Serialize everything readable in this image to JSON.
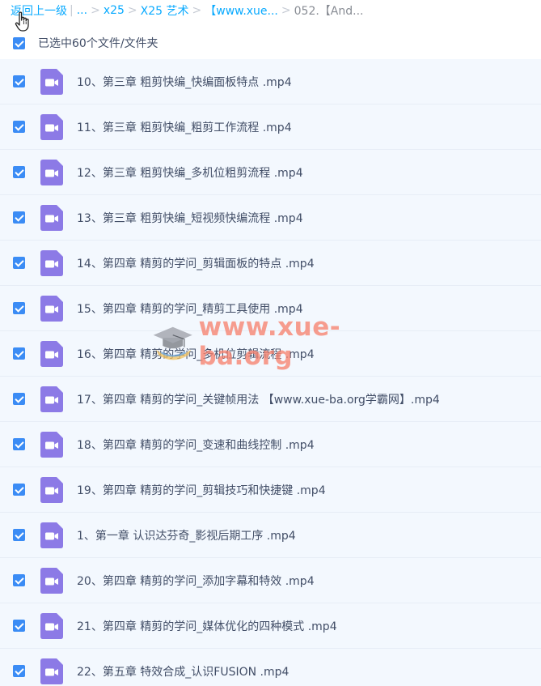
{
  "breadcrumb": {
    "back": "返回上一级",
    "pipe": "|",
    "ellipsis": "...",
    "sep": ">",
    "items": [
      "x25",
      "X25 艺术",
      "【www.xue..."
    ],
    "current": "052.【And..."
  },
  "selection": {
    "label": "已选中60个文件/文件夹"
  },
  "files": [
    {
      "name": "10、第三章 粗剪快编_快编面板特点 .mp4",
      "icon": "video-file-icon"
    },
    {
      "name": "11、第三章 粗剪快编_粗剪工作流程 .mp4",
      "icon": "video-file-icon"
    },
    {
      "name": "12、第三章 粗剪快编_多机位粗剪流程 .mp4",
      "icon": "video-file-icon"
    },
    {
      "name": "13、第三章 粗剪快编_短视频快编流程 .mp4",
      "icon": "video-file-icon"
    },
    {
      "name": "14、第四章 精剪的学问_剪辑面板的特点 .mp4",
      "icon": "video-file-icon"
    },
    {
      "name": "15、第四章 精剪的学问_精剪工具使用 .mp4",
      "icon": "video-file-icon"
    },
    {
      "name": "16、第四章 精剪的学问_多机位剪辑流程 .mp4",
      "icon": "video-file-icon"
    },
    {
      "name": "17、第四章 精剪的学问_关键帧用法 【www.xue-ba.org学霸网】.mp4",
      "icon": "video-file-icon"
    },
    {
      "name": "18、第四章 精剪的学问_变速和曲线控制 .mp4",
      "icon": "video-file-icon"
    },
    {
      "name": "19、第四章 精剪的学问_剪辑技巧和快捷键 .mp4",
      "icon": "video-file-icon"
    },
    {
      "name": "1、第一章 认识达芬奇_影视后期工序 .mp4",
      "icon": "video-file-icon"
    },
    {
      "name": "20、第四章 精剪的学问_添加字幕和特效 .mp4",
      "icon": "video-file-icon"
    },
    {
      "name": "21、第四章 精剪的学问_媒体优化的四种模式 .mp4",
      "icon": "video-file-icon"
    },
    {
      "name": "22、第五章 特效合成_认识FUSION .mp4",
      "icon": "video-file-icon"
    }
  ],
  "watermark": {
    "text": "www.xue-ba.org"
  },
  "colors": {
    "link": "#09aaff",
    "checkbox": "#3b8cf5",
    "row_bg": "#f3f8fe",
    "video_icon": "#8c7ae6"
  }
}
